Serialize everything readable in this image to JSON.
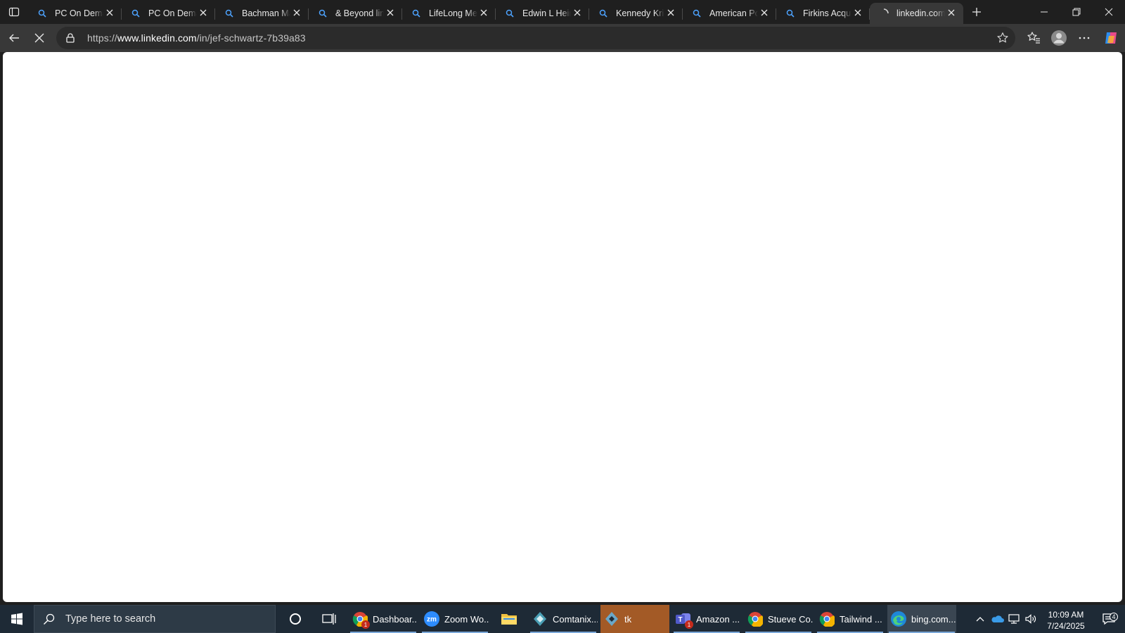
{
  "browser": {
    "tabs": [
      {
        "title": "PC On Demand",
        "icon": "search-icon",
        "active": false
      },
      {
        "title": "PC On Demand",
        "icon": "search-icon",
        "active": false
      },
      {
        "title": "Bachman Mac",
        "icon": "search-icon",
        "active": false
      },
      {
        "title": "& Beyond link",
        "icon": "search-icon",
        "active": false
      },
      {
        "title": "LifeLong Med",
        "icon": "search-icon",
        "active": false
      },
      {
        "title": "Edwin L Heim",
        "icon": "search-icon",
        "active": false
      },
      {
        "title": "Kennedy Krie",
        "icon": "search-icon",
        "active": false
      },
      {
        "title": "American Por",
        "icon": "search-icon",
        "active": false
      },
      {
        "title": "Firkins Acquis",
        "icon": "search-icon",
        "active": false
      },
      {
        "title": "linkedin.com/",
        "icon": "loading-icon",
        "active": true
      }
    ],
    "address": {
      "scheme": "https://",
      "host": "www.linkedin.com",
      "path": "/in/jef-schwartz-7b39a83"
    }
  },
  "taskbar": {
    "search_placeholder": "Type here to search",
    "apps": [
      {
        "label": "Dashboar...",
        "icon": "chrome-icon",
        "badge": "1",
        "state": "open"
      },
      {
        "label": "Zoom Wo...",
        "icon": "zoom-icon",
        "badge": "",
        "state": "open"
      },
      {
        "label": "",
        "icon": "file-explorer-icon",
        "badge": "",
        "state": "plain"
      },
      {
        "label": "Comtanix...",
        "icon": "comtanix-icon",
        "badge": "",
        "state": "open"
      },
      {
        "label": "tk",
        "icon": "python-tk-icon",
        "badge": "",
        "state": "highlight"
      },
      {
        "label": "Amazon ...",
        "icon": "teams-icon",
        "badge": "1",
        "state": "open"
      },
      {
        "label": "Stueve Co...",
        "icon": "chrome-icon",
        "badge": "",
        "state": "open"
      },
      {
        "label": "Tailwind ...",
        "icon": "chrome-icon",
        "badge": "",
        "state": "open"
      },
      {
        "label": "bing.com...",
        "icon": "edge-icon",
        "badge": "",
        "state": "active"
      }
    ],
    "clock": {
      "time": "10:09 AM",
      "date": "7/24/2025"
    },
    "notifications_count": "4"
  },
  "colors": {
    "chrome_dark": "#1f1f1f",
    "toolbar": "#383838",
    "taskbar": "#1e2a36",
    "tk_highlight": "#a35a26",
    "accent": "#3a8ee6"
  }
}
